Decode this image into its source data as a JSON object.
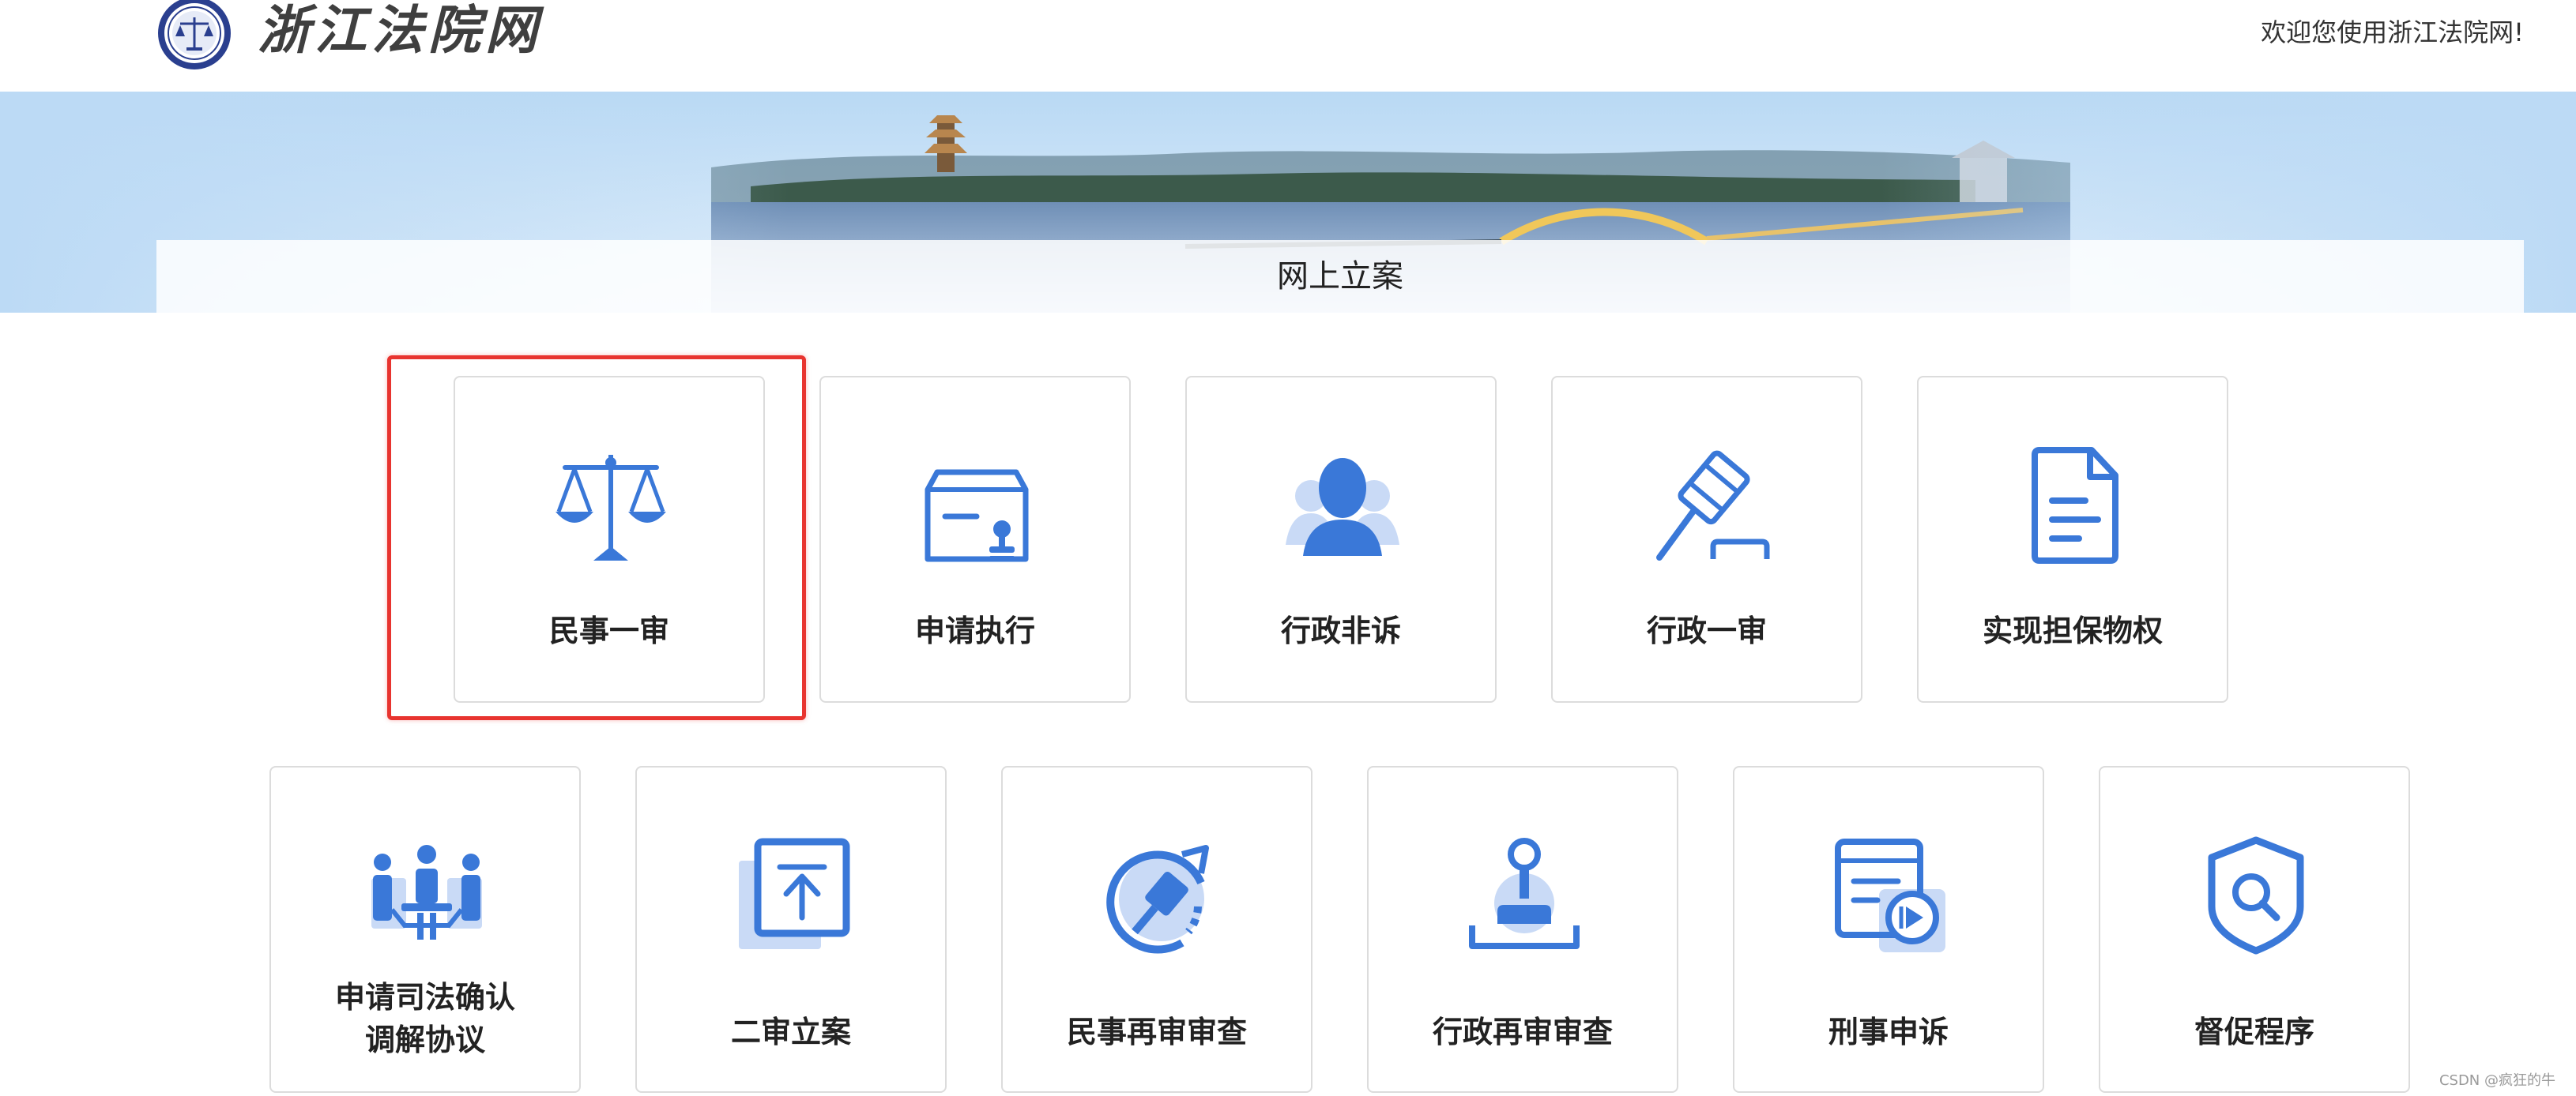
{
  "header": {
    "logo_text": "浙江法院网",
    "welcome": "欢迎您使用浙江法院网!"
  },
  "banner": {
    "title": "网上立案"
  },
  "services": {
    "row1": [
      {
        "label": "民事一审",
        "icon": "scales-icon"
      },
      {
        "label": "申请执行",
        "icon": "case-stamp-icon"
      },
      {
        "label": "行政非诉",
        "icon": "people-icon"
      },
      {
        "label": "行政一审",
        "icon": "gavel-icon"
      },
      {
        "label": "实现担保物权",
        "icon": "document-icon"
      }
    ],
    "row2": [
      {
        "label_line1": "申请司法确认",
        "label_line2": "调解协议",
        "icon": "meeting-icon"
      },
      {
        "label": "二审立案",
        "icon": "upload-box-icon"
      },
      {
        "label": "民事再审审查",
        "icon": "gavel-refresh-icon"
      },
      {
        "label": "行政再审审查",
        "icon": "stamp-icon"
      },
      {
        "label": "刑事申诉",
        "icon": "video-document-icon"
      },
      {
        "label": "督促程序",
        "icon": "shield-search-icon"
      }
    ]
  },
  "colors": {
    "icon_blue": "#3a78d8",
    "icon_light": "#c9daf6",
    "highlight": "#e8342f"
  },
  "watermark": "CSDN @疯狂的牛"
}
